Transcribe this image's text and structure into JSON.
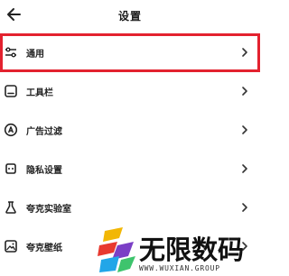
{
  "header": {
    "title": "设置",
    "back_icon": "arrow-left-icon"
  },
  "settings": {
    "items": [
      {
        "label": "通用",
        "icon": "sliders-icon",
        "highlighted": true
      },
      {
        "label": "工具栏",
        "icon": "toolbar-icon",
        "highlighted": false
      },
      {
        "label": "广告过滤",
        "icon": "ad-filter-icon",
        "highlighted": false
      },
      {
        "label": "隐私设置",
        "icon": "privacy-icon",
        "highlighted": false
      },
      {
        "label": "夸克实验室",
        "icon": "flask-icon",
        "highlighted": false
      },
      {
        "label": "夸克壁纸",
        "icon": "wallpaper-icon",
        "highlighted": false
      }
    ]
  },
  "watermark": {
    "title": "无限数码",
    "url": "WWW.WUXIAN.GROUP"
  },
  "colors": {
    "highlight": "#e3222f",
    "text": "#222222"
  }
}
